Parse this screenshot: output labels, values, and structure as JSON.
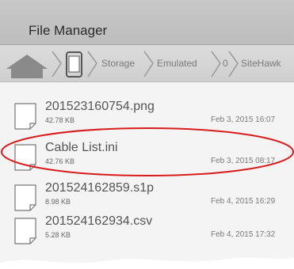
{
  "app": {
    "title": "File Manager"
  },
  "breadcrumb": [
    "Storage",
    "Emulated",
    "0",
    "SiteHawk"
  ],
  "files": [
    {
      "name": "201523160754.png",
      "size": "42.78 KB",
      "date": "Feb 3, 2015 16:07"
    },
    {
      "name": "Cable List.ini",
      "size": "42.76 KB",
      "date": "Feb 3, 2015 08:17"
    },
    {
      "name": "201524162859.s1p",
      "size": "8.98 KB",
      "date": "Feb 4, 2015 16:29"
    },
    {
      "name": "201524162934.csv",
      "size": "5.28 KB",
      "date": "Feb 4, 2015 17:32"
    }
  ],
  "colors": {
    "highlight": "#d81c1c",
    "header": "#c4c4c4",
    "text": "#555555"
  },
  "icons": [
    "home-icon",
    "phone-icon",
    "file-icon"
  ]
}
